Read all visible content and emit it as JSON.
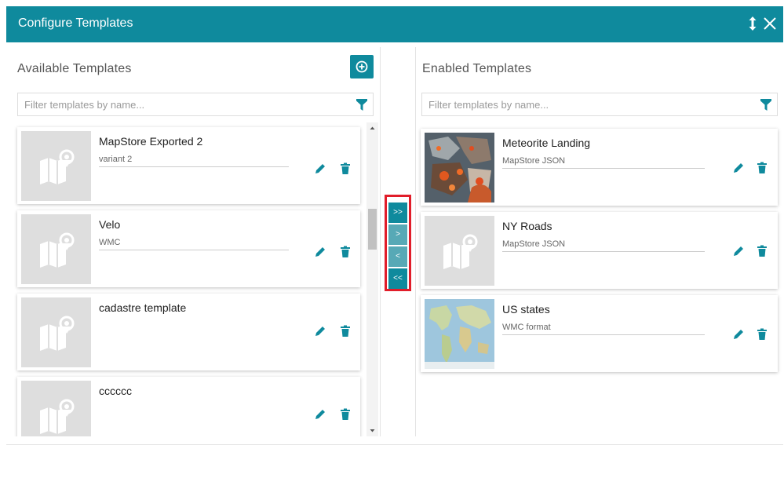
{
  "header": {
    "title": "Configure Templates"
  },
  "available": {
    "title": "Available Templates",
    "filter_placeholder": "Filter templates by name...",
    "items": [
      {
        "name": "MapStore Exported 2",
        "description": "variant 2"
      },
      {
        "name": "Velo",
        "description": "WMC"
      },
      {
        "name": "cadastre template",
        "description": ""
      },
      {
        "name": "cccccc",
        "description": ""
      }
    ]
  },
  "enabled": {
    "title": "Enabled Templates",
    "filter_placeholder": "Filter templates by name...",
    "items": [
      {
        "name": "Meteorite Landing",
        "description": "MapStore JSON"
      },
      {
        "name": "NY Roads",
        "description": "MapStore JSON"
      },
      {
        "name": "US states",
        "description": "WMC format"
      }
    ]
  },
  "transfer": {
    "move_all_right": ">>",
    "move_right": ">",
    "move_left": "<",
    "move_all_left": "<<"
  },
  "colors": {
    "accent": "#0f8a9d",
    "highlight_border": "#e11d2a",
    "thumb_placeholder": "#dedede"
  },
  "icons": [
    "expand-icon",
    "close-icon",
    "add-icon",
    "filter-icon",
    "map-placeholder-icon",
    "pencil-icon",
    "trash-icon"
  ]
}
